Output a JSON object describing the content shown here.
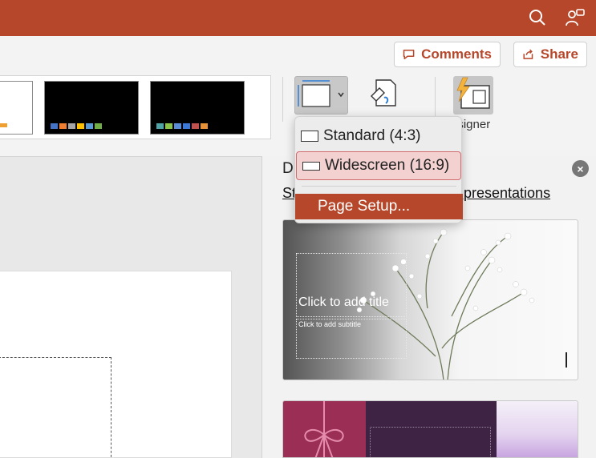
{
  "toolbar": {
    "comments_label": "Comments",
    "share_label": "Share",
    "designer_label": "esigner"
  },
  "colors": {
    "accent": "#b7472a",
    "selected_bg": "#f3d1d1",
    "selected_border": "#d26b6b"
  },
  "icons": {
    "search": "search-icon",
    "assistant": "lightbulb-person-icon",
    "comments": "speech-bubble-icon",
    "share": "share-icon",
    "slide_size": "slide-size-icon",
    "format_background": "format-background-icon",
    "designer": "designer-icon",
    "close": "close-icon"
  },
  "slide_size_menu": {
    "items": [
      {
        "label": "Standard (4:3)",
        "icon": "standard-ratio-icon",
        "selected": false
      },
      {
        "label": "Widescreen (16:9)",
        "icon": "widescreen-ratio-icon",
        "selected": true
      }
    ],
    "page_setup_label": "Page Setup..."
  },
  "designer_pane": {
    "title_partial": "D",
    "link_left": "St",
    "link_right": "w presentations",
    "card1": {
      "title_placeholder": "Click to add title",
      "subtitle_placeholder": "Click to add subtitle"
    }
  },
  "theme_thumbs": [
    {
      "dots": [
        "#4472c4",
        "#ed7d31",
        "#a5a5a5",
        "#ffc000",
        "#5b9bd5",
        "#70ad47"
      ]
    },
    {
      "dots": [
        "#4fa3a5",
        "#8bc34a",
        "#5b8dd6",
        "#3c78d8",
        "#c0504d",
        "#e69138"
      ]
    }
  ]
}
